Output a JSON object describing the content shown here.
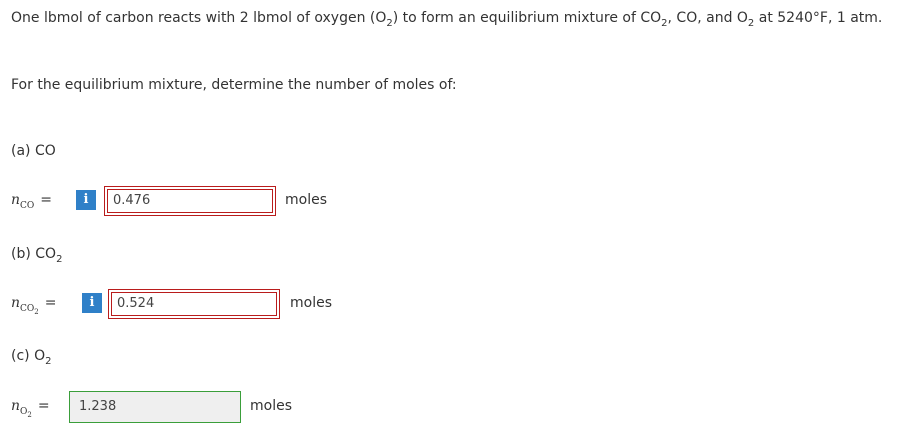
{
  "problem": {
    "intro_a": "One lbmol of carbon reacts with 2 lbmol of oxygen (O",
    "intro_sub1": "2",
    "intro_b": ") to form an equilibrium mixture of CO",
    "intro_sub2": "2",
    "intro_c": ", CO, and O",
    "intro_sub3": "2",
    "intro_d": " at 5240°F, 1 atm.",
    "prompt": "For the equilibrium mixture, determine the number of moles of:"
  },
  "parts": [
    {
      "label": "(a) CO",
      "label_sub": "",
      "var": "n",
      "var_sub": "CO",
      "var_subsub": "",
      "eq": "=",
      "info_icon": "i",
      "value": "0.476",
      "unit": "moles",
      "status": "incorrect"
    },
    {
      "label": "(b) CO",
      "label_sub": "2",
      "var": "n",
      "var_sub": "CO",
      "var_subsub": "2",
      "eq": "=",
      "info_icon": "i",
      "value": "0.524",
      "unit": "moles",
      "status": "incorrect"
    },
    {
      "label": "(c) O",
      "label_sub": "2",
      "var": "n",
      "var_sub": "O",
      "var_subsub": "2",
      "eq": "=",
      "value": "1.238",
      "unit": "moles",
      "status": "correct"
    }
  ],
  "colors": {
    "incorrect_border": "#b91c1c",
    "correct_border": "#3a9e3a",
    "info_icon_bg": "#2f80c8"
  }
}
